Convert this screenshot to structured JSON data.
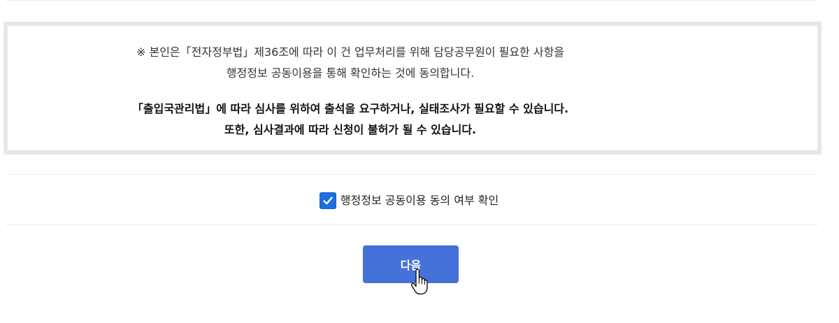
{
  "notice": {
    "line1": "※ 본인은「전자정부법」제36조에 따라 이 건 업무처리를 위해 담당공무원이 필요한 사항을",
    "line2": "행정정보 공동이용을 통해 확인하는 것에 동의합니다.",
    "line3": "「출입국관리법」에 따라 심사를 위하여 출석을 요구하거나, 실태조사가 필요할 수 있습니다.",
    "line4": "또한, 심사결과에 따라 신청이 불허가 될 수 있습니다."
  },
  "agreement": {
    "label": "행정정보 공동이용 동의 여부 확인",
    "checked": true
  },
  "actions": {
    "next_label": "다음"
  },
  "colors": {
    "checkbox": "#1c6fe0",
    "button": "#4472d9",
    "box_border": "#e7e7e7"
  },
  "icons": {
    "check": "check-icon",
    "cursor": "hand-pointer-icon"
  }
}
